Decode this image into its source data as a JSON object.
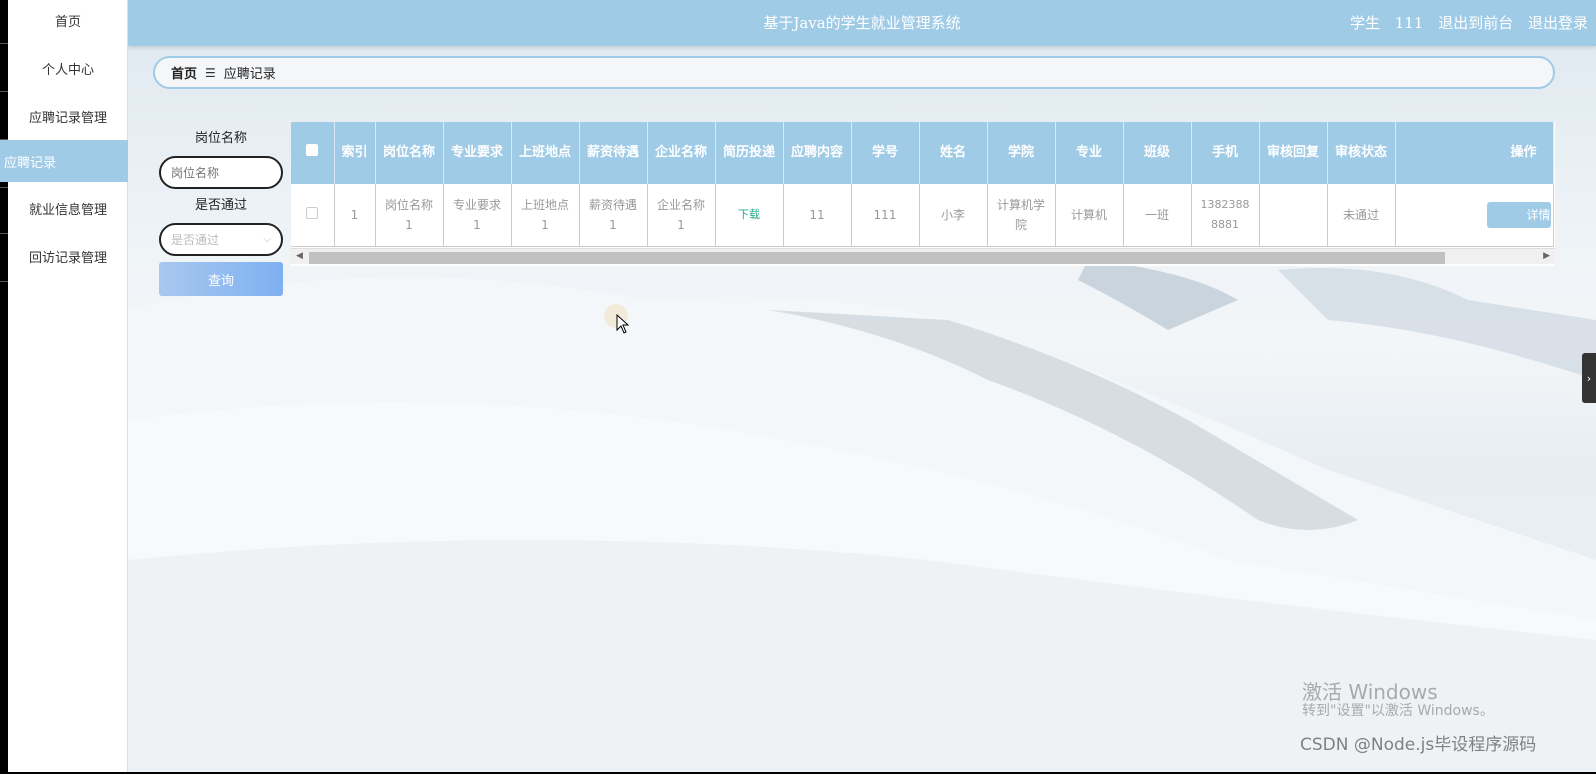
{
  "app": {
    "title": "基于Java的学生就业管理系统",
    "role": "学生",
    "username": "111",
    "to_front_label": "退出到前台",
    "logout_label": "退出登录"
  },
  "sidebar": {
    "items": [
      {
        "label": "首页"
      },
      {
        "label": "个人中心"
      },
      {
        "label": "应聘记录管理"
      },
      {
        "label": "应聘记录"
      },
      {
        "label": "就业信息管理"
      },
      {
        "label": "回访记录管理"
      }
    ],
    "active_color": "#9fcbe6"
  },
  "breadcrumb": {
    "home": "首页",
    "separator_icon": "menu-icon",
    "current": "应聘记录"
  },
  "search": {
    "position_label": "岗位名称",
    "position_placeholder": "岗位名称",
    "passed_label": "是否通过",
    "passed_placeholder": "是否通过",
    "query_button": "查询"
  },
  "table": {
    "headers": [
      "索引",
      "岗位名称",
      "专业要求",
      "上班地点",
      "薪资待遇",
      "企业名称",
      "简历投递",
      "应聘内容",
      "学号",
      "姓名",
      "学院",
      "专业",
      "班级",
      "手机",
      "审核回复",
      "审核状态",
      "操作"
    ],
    "rows": [
      {
        "index": "1",
        "position": "岗位名称1",
        "requirement": "专业要求1",
        "location": "上班地点1",
        "salary": "薪资待遇1",
        "company": "企业名称1",
        "resume": "下载",
        "content": "11",
        "student_no": "111",
        "name": "小李",
        "college": "计算机学院",
        "major": "计算机",
        "class": "一班",
        "phone": "13823888881",
        "reply": "",
        "status": "未通过",
        "action": "详情"
      }
    ],
    "header_color": "#9fcbe6"
  },
  "watermark": {
    "activate_title": "激活 Windows",
    "activate_sub": "转到\"设置\"以激活 Windows。",
    "csdn": "CSDN @Node.js毕设程序源码"
  }
}
